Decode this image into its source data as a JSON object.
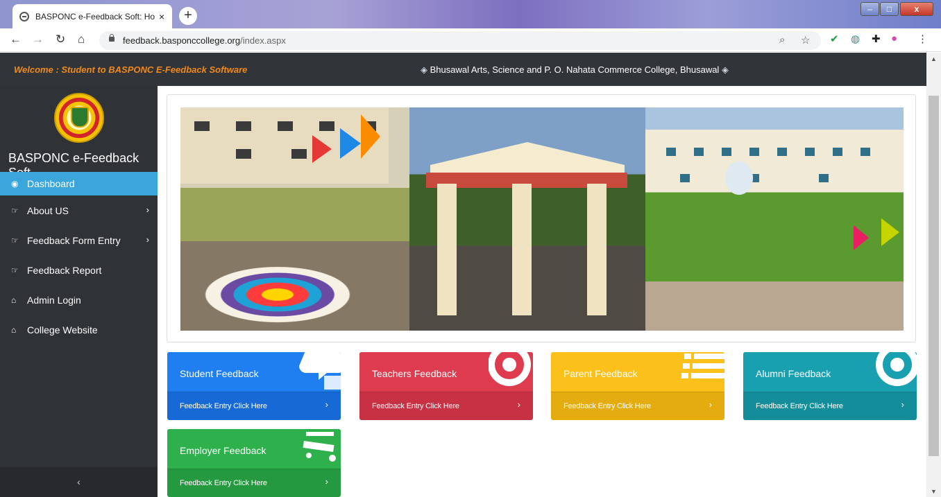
{
  "browser": {
    "tab_title": "BASPONC e-Feedback Soft: Home",
    "tab_close": "×",
    "new_tab": "+",
    "url_domain": "feedback.basponccollege.org",
    "url_path": "/index.aspx",
    "window_min": "–",
    "window_max": "□",
    "window_close": "x"
  },
  "header": {
    "welcome": "Welcome : Student to BASPONC E-Feedback Software",
    "college": "Bhusawal Arts, Science and P. O. Nahata Commerce College, Bhusawal",
    "gem": "◈"
  },
  "sidebar": {
    "brand": "BASPONC e-Feedback Soft",
    "collapse_label": "‹",
    "items": [
      {
        "label": "Dashboard",
        "icon": "dashboard-icon",
        "glyph": "◉",
        "active": true
      },
      {
        "label": "About US",
        "icon": "hand-point-icon",
        "glyph": "☞",
        "chevron": "›"
      },
      {
        "label": "Feedback Form Entry",
        "icon": "hand-point-icon",
        "glyph": "☞",
        "chevron": "›"
      },
      {
        "label": "Feedback Report",
        "icon": "hand-point-icon",
        "glyph": "☞"
      },
      {
        "label": "Admin Login",
        "icon": "home-icon",
        "glyph": "⌂"
      },
      {
        "label": "College Website",
        "icon": "home-icon",
        "glyph": "⌂"
      }
    ]
  },
  "cards": [
    {
      "title": "Student Feedback",
      "link": "Feedback Entry Click Here",
      "arrow": "›",
      "color": "#1f7ff0",
      "icon": "comments-icon"
    },
    {
      "title": "Teachers Feedback",
      "link": "Feedback Entry Click Here",
      "arrow": "›",
      "color": "#de3b4f",
      "icon": "lifebuoy-icon"
    },
    {
      "title": "Parent Feedback",
      "link": "Feedback Entry Click Here",
      "arrow": "›",
      "color": "#fbc11a",
      "icon": "list-icon"
    },
    {
      "title": "Alumni Feedback",
      "link": "Feedback Entry Click Here",
      "arrow": "›",
      "color": "#19a0b0",
      "icon": "lifebuoy-icon"
    },
    {
      "title": "Employer Feedback",
      "link": "Feedback Entry Click Here",
      "arrow": "›",
      "color": "#2eb14d",
      "icon": "cart-icon"
    }
  ]
}
